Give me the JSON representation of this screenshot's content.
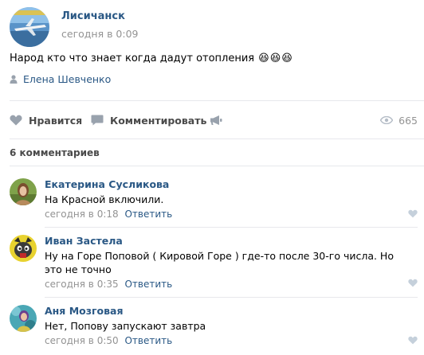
{
  "post": {
    "group_name": "Лисичанск",
    "time": "сегодня в 0:09",
    "text": "Народ кто что знает когда дадут отопления",
    "emoji": [
      "😆",
      "😆",
      "😆"
    ],
    "signer": "Елена Шевченко"
  },
  "actions": {
    "like_label": "Нравится",
    "comment_label": "Комментировать",
    "views_count": "665"
  },
  "comments_header": "6 комментариев",
  "comments": [
    {
      "author": "Екатерина Суслико­ва",
      "text": "На Красной включили.",
      "time": "сегодня в 0:18",
      "reply_label": "Ответить"
    },
    {
      "author": "Иван Застела",
      "text": "Ну на Горе Поповой ( Кировой Горе ) где-то после 30-го числа. Но это не точно",
      "time": "сегодня в 0:35",
      "reply_label": "Ответить"
    },
    {
      "author": "Аня Мозговая",
      "text": "Нет, Попову запускают завтра",
      "time": "сегодня в 0:50",
      "reply_label": "Ответить"
    }
  ],
  "colors": {
    "link": "#2a5885",
    "meta": "#939393",
    "icon": "#99a2ad",
    "separator": "#e7e8ec"
  }
}
